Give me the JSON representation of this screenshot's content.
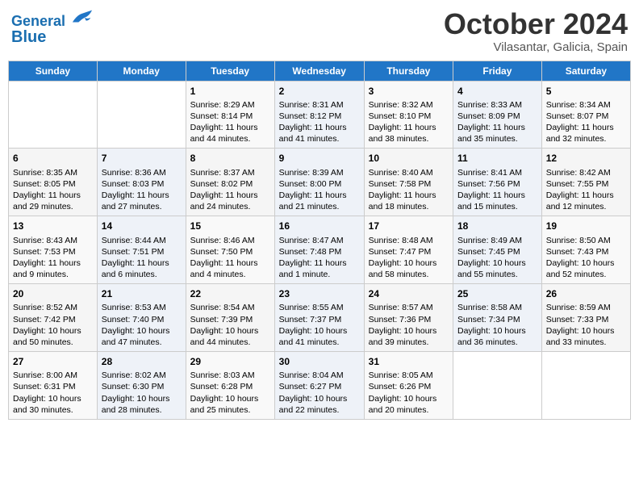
{
  "header": {
    "logo_line1": "General",
    "logo_line2": "Blue",
    "month_title": "October 2024",
    "location": "Vilasantar, Galicia, Spain"
  },
  "weekdays": [
    "Sunday",
    "Monday",
    "Tuesday",
    "Wednesday",
    "Thursday",
    "Friday",
    "Saturday"
  ],
  "weeks": [
    [
      {
        "day": null
      },
      {
        "day": null
      },
      {
        "day": "1",
        "sunrise": "Sunrise: 8:29 AM",
        "sunset": "Sunset: 8:14 PM",
        "daylight": "Daylight: 11 hours and 44 minutes."
      },
      {
        "day": "2",
        "sunrise": "Sunrise: 8:31 AM",
        "sunset": "Sunset: 8:12 PM",
        "daylight": "Daylight: 11 hours and 41 minutes."
      },
      {
        "day": "3",
        "sunrise": "Sunrise: 8:32 AM",
        "sunset": "Sunset: 8:10 PM",
        "daylight": "Daylight: 11 hours and 38 minutes."
      },
      {
        "day": "4",
        "sunrise": "Sunrise: 8:33 AM",
        "sunset": "Sunset: 8:09 PM",
        "daylight": "Daylight: 11 hours and 35 minutes."
      },
      {
        "day": "5",
        "sunrise": "Sunrise: 8:34 AM",
        "sunset": "Sunset: 8:07 PM",
        "daylight": "Daylight: 11 hours and 32 minutes."
      }
    ],
    [
      {
        "day": "6",
        "sunrise": "Sunrise: 8:35 AM",
        "sunset": "Sunset: 8:05 PM",
        "daylight": "Daylight: 11 hours and 29 minutes."
      },
      {
        "day": "7",
        "sunrise": "Sunrise: 8:36 AM",
        "sunset": "Sunset: 8:03 PM",
        "daylight": "Daylight: 11 hours and 27 minutes."
      },
      {
        "day": "8",
        "sunrise": "Sunrise: 8:37 AM",
        "sunset": "Sunset: 8:02 PM",
        "daylight": "Daylight: 11 hours and 24 minutes."
      },
      {
        "day": "9",
        "sunrise": "Sunrise: 8:39 AM",
        "sunset": "Sunset: 8:00 PM",
        "daylight": "Daylight: 11 hours and 21 minutes."
      },
      {
        "day": "10",
        "sunrise": "Sunrise: 8:40 AM",
        "sunset": "Sunset: 7:58 PM",
        "daylight": "Daylight: 11 hours and 18 minutes."
      },
      {
        "day": "11",
        "sunrise": "Sunrise: 8:41 AM",
        "sunset": "Sunset: 7:56 PM",
        "daylight": "Daylight: 11 hours and 15 minutes."
      },
      {
        "day": "12",
        "sunrise": "Sunrise: 8:42 AM",
        "sunset": "Sunset: 7:55 PM",
        "daylight": "Daylight: 11 hours and 12 minutes."
      }
    ],
    [
      {
        "day": "13",
        "sunrise": "Sunrise: 8:43 AM",
        "sunset": "Sunset: 7:53 PM",
        "daylight": "Daylight: 11 hours and 9 minutes."
      },
      {
        "day": "14",
        "sunrise": "Sunrise: 8:44 AM",
        "sunset": "Sunset: 7:51 PM",
        "daylight": "Daylight: 11 hours and 6 minutes."
      },
      {
        "day": "15",
        "sunrise": "Sunrise: 8:46 AM",
        "sunset": "Sunset: 7:50 PM",
        "daylight": "Daylight: 11 hours and 4 minutes."
      },
      {
        "day": "16",
        "sunrise": "Sunrise: 8:47 AM",
        "sunset": "Sunset: 7:48 PM",
        "daylight": "Daylight: 11 hours and 1 minute."
      },
      {
        "day": "17",
        "sunrise": "Sunrise: 8:48 AM",
        "sunset": "Sunset: 7:47 PM",
        "daylight": "Daylight: 10 hours and 58 minutes."
      },
      {
        "day": "18",
        "sunrise": "Sunrise: 8:49 AM",
        "sunset": "Sunset: 7:45 PM",
        "daylight": "Daylight: 10 hours and 55 minutes."
      },
      {
        "day": "19",
        "sunrise": "Sunrise: 8:50 AM",
        "sunset": "Sunset: 7:43 PM",
        "daylight": "Daylight: 10 hours and 52 minutes."
      }
    ],
    [
      {
        "day": "20",
        "sunrise": "Sunrise: 8:52 AM",
        "sunset": "Sunset: 7:42 PM",
        "daylight": "Daylight: 10 hours and 50 minutes."
      },
      {
        "day": "21",
        "sunrise": "Sunrise: 8:53 AM",
        "sunset": "Sunset: 7:40 PM",
        "daylight": "Daylight: 10 hours and 47 minutes."
      },
      {
        "day": "22",
        "sunrise": "Sunrise: 8:54 AM",
        "sunset": "Sunset: 7:39 PM",
        "daylight": "Daylight: 10 hours and 44 minutes."
      },
      {
        "day": "23",
        "sunrise": "Sunrise: 8:55 AM",
        "sunset": "Sunset: 7:37 PM",
        "daylight": "Daylight: 10 hours and 41 minutes."
      },
      {
        "day": "24",
        "sunrise": "Sunrise: 8:57 AM",
        "sunset": "Sunset: 7:36 PM",
        "daylight": "Daylight: 10 hours and 39 minutes."
      },
      {
        "day": "25",
        "sunrise": "Sunrise: 8:58 AM",
        "sunset": "Sunset: 7:34 PM",
        "daylight": "Daylight: 10 hours and 36 minutes."
      },
      {
        "day": "26",
        "sunrise": "Sunrise: 8:59 AM",
        "sunset": "Sunset: 7:33 PM",
        "daylight": "Daylight: 10 hours and 33 minutes."
      }
    ],
    [
      {
        "day": "27",
        "sunrise": "Sunrise: 8:00 AM",
        "sunset": "Sunset: 6:31 PM",
        "daylight": "Daylight: 10 hours and 30 minutes."
      },
      {
        "day": "28",
        "sunrise": "Sunrise: 8:02 AM",
        "sunset": "Sunset: 6:30 PM",
        "daylight": "Daylight: 10 hours and 28 minutes."
      },
      {
        "day": "29",
        "sunrise": "Sunrise: 8:03 AM",
        "sunset": "Sunset: 6:28 PM",
        "daylight": "Daylight: 10 hours and 25 minutes."
      },
      {
        "day": "30",
        "sunrise": "Sunrise: 8:04 AM",
        "sunset": "Sunset: 6:27 PM",
        "daylight": "Daylight: 10 hours and 22 minutes."
      },
      {
        "day": "31",
        "sunrise": "Sunrise: 8:05 AM",
        "sunset": "Sunset: 6:26 PM",
        "daylight": "Daylight: 10 hours and 20 minutes."
      },
      {
        "day": null
      },
      {
        "day": null
      }
    ]
  ]
}
